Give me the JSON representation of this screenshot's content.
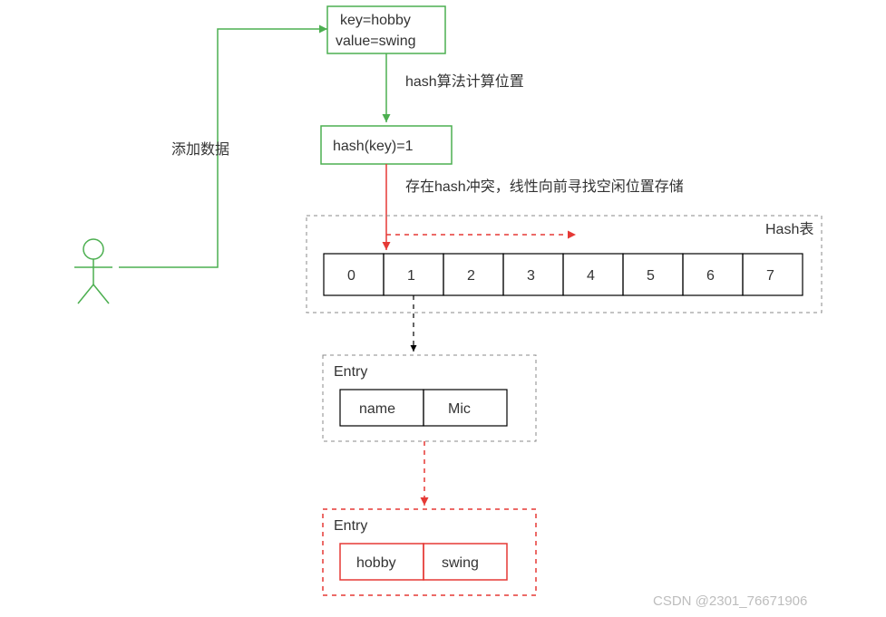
{
  "kv_box": {
    "line1_key": "key",
    "line1_eq": "=",
    "line1_val": "hobby",
    "line2_key": "value",
    "line2_eq": "=",
    "line2_val": "swing"
  },
  "hash_box": {
    "left": "hash(key)",
    "eq": "=",
    "right": "1"
  },
  "labels": {
    "add_data": "添加数据",
    "hash_calc": "hash算法计算位置",
    "collision": "存在hash冲突，线性向前寻找空闲位置存储",
    "hash_table": "Hash表",
    "entry1_title": "Entry",
    "entry2_title": "Entry"
  },
  "table_cells": [
    "0",
    "1",
    "2",
    "3",
    "4",
    "5",
    "6",
    "7"
  ],
  "entry1": {
    "key": "name",
    "value": "Mic"
  },
  "entry2": {
    "key": "hobby",
    "value": "swing"
  },
  "watermark": "CSDN @2301_76671906"
}
